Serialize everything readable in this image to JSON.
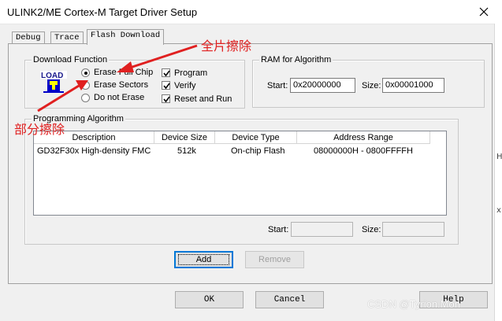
{
  "window": {
    "title": "ULINK2/ME Cortex-M Target Driver Setup"
  },
  "tabs": [
    {
      "label": "Debug"
    },
    {
      "label": "Trace"
    },
    {
      "label": "Flash Download"
    }
  ],
  "download_function": {
    "title": "Download Function",
    "icon_text": "LOAD",
    "erase_options": [
      {
        "label": "Erase Full Chip",
        "selected": true
      },
      {
        "label": "Erase Sectors",
        "selected": false
      },
      {
        "label": "Do not Erase",
        "selected": false
      }
    ],
    "checks": [
      {
        "label": "Program",
        "checked": true
      },
      {
        "label": "Verify",
        "checked": true
      },
      {
        "label": "Reset and Run",
        "checked": true
      }
    ]
  },
  "ram": {
    "title": "RAM for Algorithm",
    "start_label": "Start:",
    "start_value": "0x20000000",
    "size_label": "Size:",
    "size_value": "0x00001000"
  },
  "programming": {
    "title": "Programming Algorithm",
    "columns": [
      "Description",
      "Device Size",
      "Device Type",
      "Address Range"
    ],
    "rows": [
      [
        "GD32F30x High-density FMC",
        "512k",
        "On-chip Flash",
        "08000000H - 0800FFFFH"
      ]
    ],
    "start_label": "Start:",
    "start_value": "",
    "size_label": "Size:",
    "size_value": ""
  },
  "buttons": {
    "add": "Add",
    "remove": "Remove",
    "ok": "OK",
    "cancel": "Cancel",
    "help": "Help"
  },
  "annotations": {
    "full_chip": "全片擦除",
    "sectors": "部分擦除"
  },
  "watermark": "CSDN @Tyrion.Mon",
  "edge_chars": [
    "H",
    "x"
  ],
  "colors": {
    "annotation": "#e02020",
    "focus": "#0078d7"
  }
}
